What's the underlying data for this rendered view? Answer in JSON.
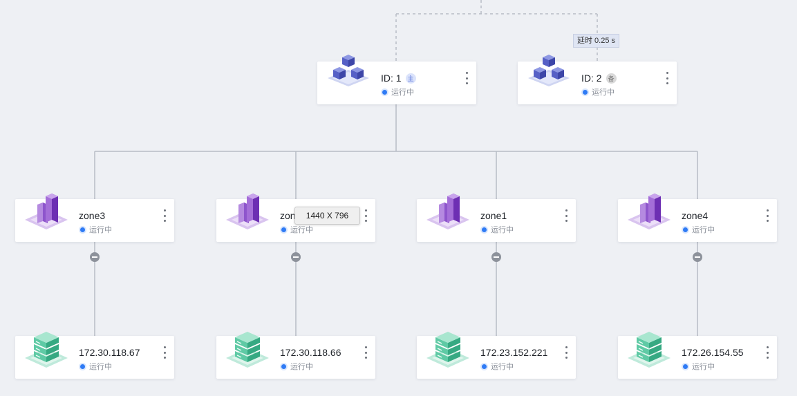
{
  "topology": {
    "delay_label": "延时 0.25 s",
    "tooltip": "1440 X 796",
    "controllers": [
      {
        "title": "ID: 1",
        "role_badge": "主",
        "status": "运行中"
      },
      {
        "title": "ID: 2",
        "role_badge": "备",
        "status": "运行中"
      }
    ],
    "zones": [
      {
        "name": "zone3",
        "status": "运行中"
      },
      {
        "name": "zone2",
        "status": "运行中"
      },
      {
        "name": "zone1",
        "status": "运行中"
      },
      {
        "name": "zone4",
        "status": "运行中"
      }
    ],
    "hosts": [
      {
        "ip": "172.30.118.67",
        "status": "运行中"
      },
      {
        "ip": "172.30.118.66",
        "status": "运行中"
      },
      {
        "ip": "172.23.152.221",
        "status": "运行中"
      },
      {
        "ip": "172.26.154.55",
        "status": "运行中"
      }
    ]
  },
  "colors": {
    "background": "#eef0f4",
    "status_dot": "#2f7bf5",
    "connector": "#b7bcc5",
    "controller_icon": "#4b55b5",
    "zone_icon": "#7b3fc4",
    "host_icon": "#3fb996"
  },
  "icons": {
    "controller": "cluster-cubes-icon",
    "zone": "building-icon",
    "host": "server-stack-icon",
    "more": "more-vertical-icon",
    "collapse": "collapse-minus-icon"
  }
}
